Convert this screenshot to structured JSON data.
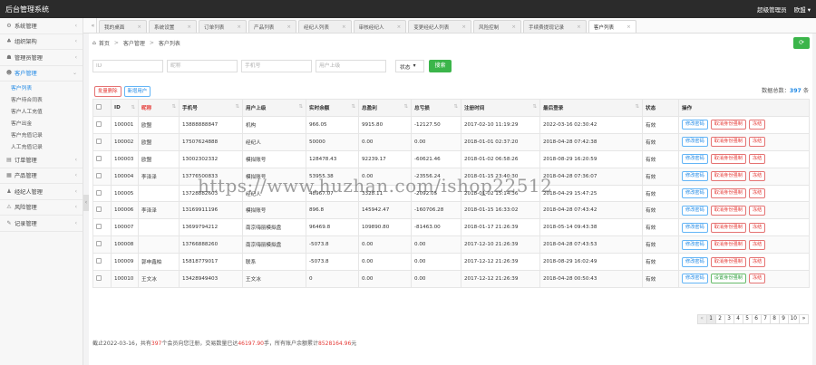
{
  "app": {
    "title": "后台管理系统",
    "user_role": "超级管理员",
    "username": "欧盟",
    "user_caret": "▾"
  },
  "sidebar": {
    "items": [
      {
        "label": "系统管理",
        "icon": "gear-icon",
        "glyph": "⚙",
        "chev": "‹"
      },
      {
        "label": "组织架构",
        "icon": "org-icon",
        "glyph": "♣",
        "chev": "‹"
      },
      {
        "label": "管理员管理",
        "icon": "user-icon",
        "glyph": "☗",
        "chev": "‹"
      },
      {
        "label": "客户管理",
        "icon": "customer-icon",
        "glyph": "☻",
        "chev": "⌄",
        "active": true,
        "children": [
          "客户列表",
          "客户待合同表",
          "客户人工充值",
          "客户出金",
          "客户充值记录",
          "人工充值记录"
        ]
      },
      {
        "label": "订单管理",
        "icon": "order-icon",
        "glyph": "▤",
        "chev": "‹"
      },
      {
        "label": "产品管理",
        "icon": "product-icon",
        "glyph": "▦",
        "chev": "‹"
      },
      {
        "label": "经纪人管理",
        "icon": "agent-icon",
        "glyph": "♟",
        "chev": "‹"
      },
      {
        "label": "风险管理",
        "icon": "risk-icon",
        "glyph": "⚠",
        "chev": "‹"
      },
      {
        "label": "记录管理",
        "icon": "record-icon",
        "glyph": "✎",
        "chev": "‹"
      }
    ]
  },
  "tabs": {
    "prev_glyph": "«",
    "items": [
      {
        "label": "我的桌面",
        "close": "×"
      },
      {
        "label": "系统设置",
        "close": "×"
      },
      {
        "label": "订单列表",
        "close": "×"
      },
      {
        "label": "产品列表",
        "close": "×"
      },
      {
        "label": "经纪人列表",
        "close": "×"
      },
      {
        "label": "审核经纪人",
        "close": "×"
      },
      {
        "label": "变更经纪人列表",
        "close": "×"
      },
      {
        "label": "风险控制",
        "close": "×"
      },
      {
        "label": "手续费提现记录",
        "close": "×"
      },
      {
        "label": "客户列表",
        "close": "×",
        "active": true
      }
    ]
  },
  "breadcrumb": {
    "home_glyph": "⌂",
    "items": [
      "首页",
      "客户管理",
      "客户列表"
    ],
    "sep": ">"
  },
  "refresh_glyph": "⟳",
  "filter": {
    "placeholders": [
      "ID",
      "昵称",
      "手机号",
      "用户上级"
    ],
    "status_label": "状态",
    "status_caret": "▾",
    "search_label": "搜索"
  },
  "actions": {
    "batch_delete": "批量删除",
    "add_user": "新增用户"
  },
  "total": {
    "label": "数据总数：",
    "count": "397",
    "unit": "条"
  },
  "table": {
    "sort_glyph": "⇅",
    "headers": [
      "ID",
      "昵称",
      "手机号",
      "用户上级",
      "实时余额",
      "总盈利",
      "总亏损",
      "注册时间",
      "最后登录",
      "状态",
      "操作"
    ],
    "row_buttons": {
      "edit": "修改密码",
      "cancel": "取消身份强制",
      "cancel_alt": "设置身份强制",
      "disable": "冻结"
    },
    "rows": [
      [
        "100001",
        "欧盟",
        "13888888847",
        "机构",
        "966.05",
        "9915.80",
        "-12127.50",
        "2017-02-10 11:19:29",
        "2022-03-16 02:30:42",
        "有效"
      ],
      [
        "100002",
        "欧盟",
        "17507624888",
        "经纪人",
        "50000",
        "0.00",
        "0.00",
        "2018-01-01 02:37:20",
        "2018-04-28 07:42:38",
        "有效"
      ],
      [
        "100003",
        "欧盟",
        "13002302332",
        "模拟账号",
        "128478.43",
        "92239.17",
        "-60621.46",
        "2018-01-02 06:58:26",
        "2018-08-29 16:20:59",
        "有效"
      ],
      [
        "100004",
        "李泽泽",
        "13776500833",
        "模拟账号",
        "53955.38",
        "0.00",
        "-23556.24",
        "2018-01-15 23:40:30",
        "2018-04-28 07:36:07",
        "有效"
      ],
      [
        "100005",
        "",
        "13728882603",
        "经纪人",
        "48967.07",
        "3328.11",
        "-2092.05",
        "2018-01-02 15:14:36",
        "2018-04-29 15:47:25",
        "有效"
      ],
      [
        "100006",
        "李泽泽",
        "13169911196",
        "模拟账号",
        "896.8",
        "145942.47",
        "-160706.28",
        "2018-01-15 16:33:02",
        "2018-04-28 07:43:42",
        "有效"
      ],
      [
        "100007",
        "",
        "13699794212",
        "南京嗨丽模拟盘",
        "96469.8",
        "109890.80",
        "-81463.00",
        "2018-01-17 21:26:39",
        "2018-05-14 09:43:38",
        "有效"
      ],
      [
        "100008",
        "",
        "13766888260",
        "南京嗨丽模拟盘",
        "-5073.8",
        "0.00",
        "0.00",
        "2017-12-10 21:26:39",
        "2018-04-28 07:43:53",
        "有效"
      ],
      [
        "100009",
        "郭申鑫柏",
        "15818779017",
        "联系",
        "-5073.8",
        "0.00",
        "0.00",
        "2017-12-12 21:26:39",
        "2018-08-29 16:02:49",
        "有效"
      ],
      [
        "100010",
        "王文冰",
        "13428949403",
        "王文冰",
        "0",
        "0.00",
        "0.00",
        "2017-12-12 21:26:39",
        "2018-04-28 00:50:43",
        "有效"
      ]
    ]
  },
  "pagination": {
    "prev": "«",
    "pages": [
      "1",
      "2",
      "3",
      "4",
      "5",
      "6",
      "7",
      "8",
      "9",
      "10"
    ],
    "next": "»",
    "current": "1"
  },
  "footer": {
    "prefix": "截止2022-03-16，共有",
    "members": "397",
    "mid1": "个会员向您注册，交易数量已达",
    "volume": "46197.90",
    "mid2": "手，所有账户余额累计",
    "balance": "8528164.96",
    "suffix": "元"
  },
  "watermark": "https://www.huzhan.com/ishop22512"
}
